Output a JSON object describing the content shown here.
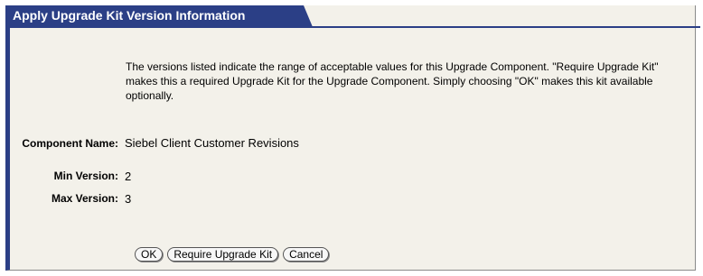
{
  "dialog": {
    "title": "Apply Upgrade Kit Version Information",
    "description": "The versions listed indicate the range of acceptable values for this Upgrade Component. \"Require Upgrade Kit\" makes this a required Upgrade Kit for the Upgrade Component. Simply choosing \"OK\" makes this kit available optionally."
  },
  "fields": {
    "component_name": {
      "label": "Component Name:",
      "value": "Siebel Client Customer Revisions"
    },
    "min_version": {
      "label": "Min Version:",
      "value": "2"
    },
    "max_version": {
      "label": "Max Version:",
      "value": "3"
    }
  },
  "buttons": {
    "ok": "OK",
    "require_upgrade_kit": "Require Upgrade Kit",
    "cancel": "Cancel"
  },
  "colors": {
    "title_bar": "#2b3f86",
    "panel_background": "#f3f1ea"
  }
}
